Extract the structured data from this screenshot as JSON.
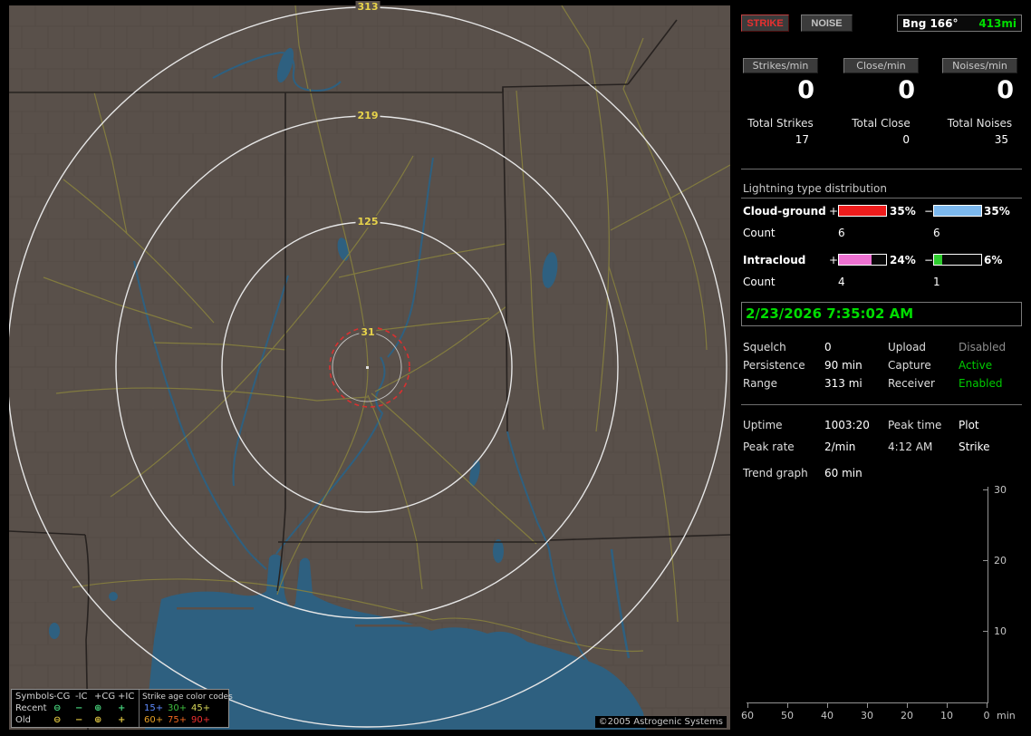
{
  "map": {
    "ring_labels": [
      "313",
      "219",
      "125",
      "31"
    ],
    "copyright": "©2005 Astrogenic Systems",
    "legend": {
      "symbols_header": "Symbols",
      "type_headers": [
        "-CG",
        "-IC",
        "+CG",
        "+IC"
      ],
      "age_header": "Strike age color codes",
      "recent_label": "Recent",
      "old_label": "Old",
      "symbols": [
        "⊖",
        "−",
        "⊕",
        "+"
      ],
      "recent_ages": [
        "15+",
        "30+",
        "45+"
      ],
      "old_ages": [
        "60+",
        "75+",
        "90+"
      ]
    }
  },
  "sidebar": {
    "strike_button": "STRIKE",
    "noise_button": "NOISE",
    "bearing": "Bng 166°",
    "distance": "413mi",
    "rate_columns": [
      {
        "label": "Strikes/min",
        "rate": "0",
        "total_label": "Total Strikes",
        "total": "17"
      },
      {
        "label": "Close/min",
        "rate": "0",
        "total_label": "Total Close",
        "total": "0"
      },
      {
        "label": "Noises/min",
        "rate": "0",
        "total_label": "Total Noises",
        "total": "35"
      }
    ],
    "distribution": {
      "header": "Lightning type distribution",
      "count_label": "Count",
      "plus_sign": "+",
      "minus_sign": "−",
      "rows": [
        {
          "label": "Cloud-ground",
          "plus_pct": "35%",
          "minus_pct": "35%",
          "plus_count": "6",
          "minus_count": "6",
          "plus_color": "#ee1c1c",
          "minus_color": "#7cb8ee",
          "plus_fill": 100,
          "minus_fill": 100
        },
        {
          "label": "Intracloud",
          "plus_pct": "24%",
          "minus_pct": "6%",
          "plus_count": "4",
          "minus_count": "1",
          "plus_color": "#ee72d2",
          "minus_color": "#2ecc2e",
          "plus_fill": 69,
          "minus_fill": 17
        }
      ]
    },
    "clock": "2/23/2026 7:35:02 AM",
    "settings": [
      {
        "label1": "Squelch",
        "value1": "0",
        "label2": "Upload",
        "value2": "Disabled"
      },
      {
        "label1": "Persistence",
        "value1": "90 min",
        "label2": "Capture",
        "value2": "Active"
      },
      {
        "label1": "Range",
        "value1": "313 mi",
        "label2": "Receiver",
        "value2": "Enabled"
      }
    ],
    "info": [
      {
        "label1": "Uptime",
        "value1": "1003:20",
        "label2": "Peak time",
        "value2": "Plot"
      },
      {
        "label1": "Peak rate",
        "value1": "2/min",
        "label2": "4:12 AM",
        "value2": "Strike"
      }
    ],
    "trend_label": "Trend graph",
    "trend_value": "60 min",
    "trend_graph": {
      "y_ticks": [
        "30",
        "20",
        "10"
      ],
      "x_ticks": [
        "60",
        "50",
        "40",
        "30",
        "20",
        "10",
        "0"
      ],
      "x_unit": "min",
      "series": []
    }
  },
  "colors": {
    "strike_accent": "#e83030",
    "status_green": "#00dd00",
    "ring_label_yellow": "#e8d44a",
    "map_land": "#59504a",
    "map_water": "#2e6080",
    "cg_plus": "#ee1c1c",
    "cg_minus": "#7cb8ee",
    "ic_plus": "#ee72d2",
    "ic_minus": "#2ecc2e"
  }
}
